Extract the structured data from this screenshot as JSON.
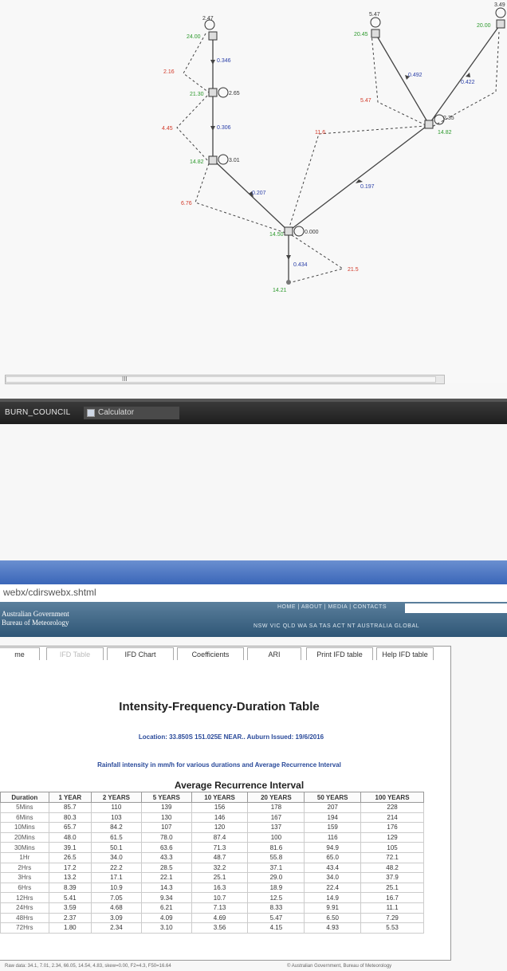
{
  "graph": {
    "nodes": [
      {
        "id": "n1",
        "elev": "24.00",
        "top": "2.47"
      },
      {
        "id": "n2",
        "elev": "21.30",
        "side": "2.65"
      },
      {
        "id": "n3",
        "elev": "14.82",
        "side": "3.01"
      },
      {
        "id": "n4",
        "elev": "14.50",
        "side": "0.000"
      },
      {
        "id": "n5",
        "elev": "14.21"
      },
      {
        "id": "n6",
        "elev": "20.45",
        "top": "5.47"
      },
      {
        "id": "n7",
        "elev": "20.00",
        "top": "3.49"
      },
      {
        "id": "n8",
        "elev": "14.82",
        "side": "2.35"
      }
    ],
    "pipe_labels": [
      "0.346",
      "0.306",
      "0.207",
      "0.434",
      "0.197",
      "0.492",
      "0.422"
    ],
    "red_labels": [
      "2.16",
      "4.45",
      "6.76",
      "21.5",
      "11.6",
      "5.47"
    ],
    "scroll_grip": "III"
  },
  "taskbar": {
    "item1": "BURN_COUNCIL",
    "item2": "Calculator"
  },
  "browser": {
    "address": "webx/cdirswebx.shtml"
  },
  "site": {
    "logo_line1": "Australian Government",
    "logo_line2": "Bureau of Meteorology",
    "toplinks": "HOME | ABOUT | MEDIA | CONTACTS",
    "states": "NSW  VIC  QLD  WA  SA  TAS  ACT  NT  AUSTRALIA  GLOBAL"
  },
  "tabs": [
    "me",
    "IFD Table",
    "IFD Chart",
    "Coefficients",
    "ARI",
    "Print IFD table",
    "Help IFD table"
  ],
  "page": {
    "title": "Intensity-Frequency-Duration Table",
    "location": "Location: 33.850S  151.025E  NEAR.. Auburn  Issued: 19/6/2016",
    "subtitle": "Rainfall intensity in mm/h for various durations and Average Recurrence Interval",
    "ari_title": "Average Recurrence Interval"
  },
  "table": {
    "headers": [
      "Duration",
      "1 YEAR",
      "2 YEARS",
      "5 YEARS",
      "10 YEARS",
      "20 YEARS",
      "50 YEARS",
      "100 YEARS"
    ],
    "rows": [
      [
        "5Mins",
        "85.7",
        "110",
        "139",
        "156",
        "178",
        "207",
        "228"
      ],
      [
        "6Mins",
        "80.3",
        "103",
        "130",
        "146",
        "167",
        "194",
        "214"
      ],
      [
        "10Mins",
        "65.7",
        "84.2",
        "107",
        "120",
        "137",
        "159",
        "176"
      ],
      [
        "20Mins",
        "48.0",
        "61.5",
        "78.0",
        "87.4",
        "100",
        "116",
        "129"
      ],
      [
        "30Mins",
        "39.1",
        "50.1",
        "63.6",
        "71.3",
        "81.6",
        "94.9",
        "105"
      ],
      [
        "1Hr",
        "26.5",
        "34.0",
        "43.3",
        "48.7",
        "55.8",
        "65.0",
        "72.1"
      ],
      [
        "2Hrs",
        "17.2",
        "22.2",
        "28.5",
        "32.2",
        "37.1",
        "43.4",
        "48.2"
      ],
      [
        "3Hrs",
        "13.2",
        "17.1",
        "22.1",
        "25.1",
        "29.0",
        "34.0",
        "37.9"
      ],
      [
        "6Hrs",
        "8.39",
        "10.9",
        "14.3",
        "16.3",
        "18.9",
        "22.4",
        "25.1"
      ],
      [
        "12Hrs",
        "5.41",
        "7.05",
        "9.34",
        "10.7",
        "12.5",
        "14.9",
        "16.7"
      ],
      [
        "24Hrs",
        "3.59",
        "4.68",
        "6.21",
        "7.13",
        "8.33",
        "9.91",
        "11.1"
      ],
      [
        "48Hrs",
        "2.37",
        "3.09",
        "4.09",
        "4.69",
        "5.47",
        "6.50",
        "7.29"
      ],
      [
        "72Hrs",
        "1.80",
        "2.34",
        "3.10",
        "3.56",
        "4.15",
        "4.93",
        "5.53"
      ]
    ]
  },
  "footer": {
    "raw": "Raw data: 34.1, 7.01, 2.34, 66.05, 14.54, 4.83, skew=0.00, F2=4.3, F50=16.64",
    "copyright": "© Australian Government, Bureau of Meteorology"
  },
  "colors": {
    "node_green": "#2e9a2e",
    "label_blue": "#2a3fa8",
    "label_red": "#d23a2a",
    "header_blue": "#3b6486"
  }
}
